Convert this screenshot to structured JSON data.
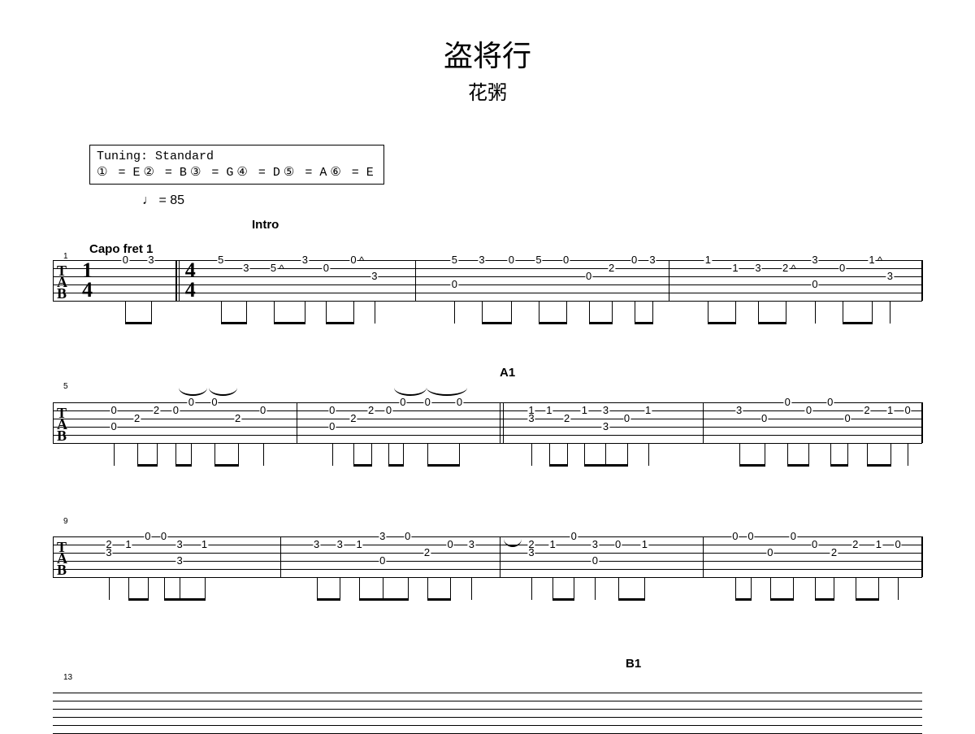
{
  "title": "盗将行",
  "artist": "花粥",
  "tuning": {
    "label": "Tuning: Standard",
    "strings": [
      {
        "num": "①",
        "note": "E"
      },
      {
        "num": "②",
        "note": "B"
      },
      {
        "num": "③",
        "note": "G"
      },
      {
        "num": "④",
        "note": "D"
      },
      {
        "num": "⑤",
        "note": "A"
      },
      {
        "num": "⑥",
        "note": "E"
      }
    ]
  },
  "tempo": {
    "note": "♩",
    "eq": "=",
    "bpm": "85"
  },
  "capo": "Capo fret 1",
  "sections": {
    "intro": "Intro",
    "a1": "A1",
    "b1": "B1"
  },
  "time_signatures": {
    "pickup": {
      "num": "1",
      "den": "4"
    },
    "main": {
      "num": "4",
      "den": "4"
    }
  },
  "bar_numbers": [
    "1",
    "5",
    "9",
    "13"
  ],
  "chart_data": {
    "type": "table",
    "description": "Guitar tablature - 6-line TAB, fret numbers on strings 1-6 (top=string1)",
    "systems": [
      {
        "bars": [
          {
            "label": "pickup",
            "timesig": "1/4",
            "notes": [
              {
                "x": 0.36,
                "string": 1,
                "fret": "0"
              },
              {
                "x": 0.7,
                "string": 1,
                "fret": "3"
              }
            ]
          },
          {
            "timesig": "4/4",
            "notes": [
              {
                "x": 0.1,
                "string": 1,
                "fret": "5"
              },
              {
                "x": 0.22,
                "string": 2,
                "fret": "3"
              },
              {
                "x": 0.35,
                "string": 2,
                "fret": "5",
                "tech": "^"
              },
              {
                "x": 0.5,
                "string": 1,
                "fret": "3"
              },
              {
                "x": 0.6,
                "string": 2,
                "fret": "0"
              },
              {
                "x": 0.73,
                "string": 1,
                "fret": "0",
                "tech": "^"
              },
              {
                "x": 0.83,
                "string": 3,
                "fret": "3"
              }
            ]
          },
          {
            "notes": [
              {
                "x": 0.08,
                "string": 1,
                "fret": "5"
              },
              {
                "x": 0.08,
                "string": 4,
                "fret": "0"
              },
              {
                "x": 0.2,
                "string": 1,
                "fret": "3"
              },
              {
                "x": 0.33,
                "string": 1,
                "fret": "0"
              },
              {
                "x": 0.45,
                "string": 1,
                "fret": "5"
              },
              {
                "x": 0.57,
                "string": 1,
                "fret": "0"
              },
              {
                "x": 0.67,
                "string": 3,
                "fret": "0"
              },
              {
                "x": 0.77,
                "string": 2,
                "fret": "2"
              },
              {
                "x": 0.87,
                "string": 1,
                "fret": "0"
              },
              {
                "x": 0.95,
                "string": 1,
                "fret": "3"
              }
            ]
          },
          {
            "notes": [
              {
                "x": 0.08,
                "string": 1,
                "fret": "1"
              },
              {
                "x": 0.2,
                "string": 2,
                "fret": "1"
              },
              {
                "x": 0.3,
                "string": 2,
                "fret": "3"
              },
              {
                "x": 0.42,
                "string": 2,
                "fret": "2",
                "tech": "^"
              },
              {
                "x": 0.55,
                "string": 1,
                "fret": "3"
              },
              {
                "x": 0.55,
                "string": 4,
                "fret": "0"
              },
              {
                "x": 0.67,
                "string": 2,
                "fret": "0"
              },
              {
                "x": 0.8,
                "string": 1,
                "fret": "1",
                "tech": "^"
              },
              {
                "x": 0.88,
                "string": 3,
                "fret": "3"
              }
            ]
          }
        ]
      },
      {
        "bars": [
          {
            "notes": [
              {
                "x": 0.08,
                "string": 2,
                "fret": "0"
              },
              {
                "x": 0.08,
                "string": 4,
                "fret": "0"
              },
              {
                "x": 0.2,
                "string": 3,
                "fret": "2"
              },
              {
                "x": 0.3,
                "string": 2,
                "fret": "2"
              },
              {
                "x": 0.4,
                "string": 2,
                "fret": "0"
              },
              {
                "x": 0.48,
                "string": 1,
                "fret": "0",
                "tie": true
              },
              {
                "x": 0.6,
                "string": 1,
                "fret": "0"
              },
              {
                "x": 0.72,
                "string": 3,
                "fret": "2"
              },
              {
                "x": 0.85,
                "string": 2,
                "fret": "0"
              }
            ]
          },
          {
            "notes": [
              {
                "x": 0.08,
                "string": 2,
                "fret": "0"
              },
              {
                "x": 0.08,
                "string": 4,
                "fret": "0"
              },
              {
                "x": 0.2,
                "string": 3,
                "fret": "2"
              },
              {
                "x": 0.3,
                "string": 2,
                "fret": "2"
              },
              {
                "x": 0.4,
                "string": 2,
                "fret": "0"
              },
              {
                "x": 0.48,
                "string": 1,
                "fret": "0",
                "tie": true
              },
              {
                "x": 0.62,
                "string": 1,
                "fret": "0",
                "tie": true
              },
              {
                "x": 0.8,
                "string": 1,
                "fret": "0"
              }
            ]
          },
          {
            "section": "A1",
            "notes": [
              {
                "x": 0.06,
                "string": 2,
                "fret": "1"
              },
              {
                "x": 0.06,
                "string": 3,
                "fret": "3"
              },
              {
                "x": 0.16,
                "string": 2,
                "fret": "1"
              },
              {
                "x": 0.26,
                "string": 3,
                "fret": "2"
              },
              {
                "x": 0.36,
                "string": 2,
                "fret": "1"
              },
              {
                "x": 0.48,
                "string": 2,
                "fret": "3"
              },
              {
                "x": 0.48,
                "string": 4,
                "fret": "3"
              },
              {
                "x": 0.6,
                "string": 3,
                "fret": "0"
              },
              {
                "x": 0.72,
                "string": 2,
                "fret": "1"
              }
            ]
          },
          {
            "notes": [
              {
                "x": 0.08,
                "string": 2,
                "fret": "3"
              },
              {
                "x": 0.21,
                "string": 3,
                "fret": "0"
              },
              {
                "x": 0.33,
                "string": 1,
                "fret": "0"
              },
              {
                "x": 0.44,
                "string": 2,
                "fret": "0"
              },
              {
                "x": 0.55,
                "string": 1,
                "fret": "0"
              },
              {
                "x": 0.64,
                "string": 3,
                "fret": "0"
              },
              {
                "x": 0.74,
                "string": 2,
                "fret": "2"
              },
              {
                "x": 0.86,
                "string": 2,
                "fret": "1"
              },
              {
                "x": 0.95,
                "string": 2,
                "fret": "0"
              }
            ]
          }
        ]
      },
      {
        "bars": [
          {
            "notes": [
              {
                "x": 0.06,
                "string": 2,
                "fret": "2"
              },
              {
                "x": 0.06,
                "string": 3,
                "fret": "3"
              },
              {
                "x": 0.17,
                "string": 2,
                "fret": "1"
              },
              {
                "x": 0.28,
                "string": 1,
                "fret": "0"
              },
              {
                "x": 0.37,
                "string": 1,
                "fret": "0"
              },
              {
                "x": 0.46,
                "string": 2,
                "fret": "3"
              },
              {
                "x": 0.46,
                "string": 4,
                "fret": "3"
              },
              {
                "x": 0.6,
                "string": 2,
                "fret": "1"
              }
            ]
          },
          {
            "notes": [
              {
                "x": 0.08,
                "string": 2,
                "fret": "3"
              },
              {
                "x": 0.2,
                "string": 2,
                "fret": "3"
              },
              {
                "x": 0.3,
                "string": 2,
                "fret": "1"
              },
              {
                "x": 0.42,
                "string": 1,
                "fret": "3"
              },
              {
                "x": 0.42,
                "string": 4,
                "fret": "0"
              },
              {
                "x": 0.55,
                "string": 1,
                "fret": "0"
              },
              {
                "x": 0.65,
                "string": 3,
                "fret": "2"
              },
              {
                "x": 0.77,
                "string": 2,
                "fret": "0"
              },
              {
                "x": 0.88,
                "string": 2,
                "fret": "3"
              }
            ]
          },
          {
            "notes": [
              {
                "x": 0.06,
                "string": 2,
                "fret": "2",
                "tie": true
              },
              {
                "x": 0.06,
                "string": 3,
                "fret": "3"
              },
              {
                "x": 0.18,
                "string": 2,
                "fret": "1"
              },
              {
                "x": 0.3,
                "string": 1,
                "fret": "0"
              },
              {
                "x": 0.42,
                "string": 2,
                "fret": "3"
              },
              {
                "x": 0.42,
                "string": 4,
                "fret": "0"
              },
              {
                "x": 0.55,
                "string": 2,
                "fret": "0"
              },
              {
                "x": 0.7,
                "string": 2,
                "fret": "1"
              }
            ]
          },
          {
            "notes": [
              {
                "x": 0.06,
                "string": 1,
                "fret": "0"
              },
              {
                "x": 0.14,
                "string": 1,
                "fret": "0"
              },
              {
                "x": 0.24,
                "string": 3,
                "fret": "0"
              },
              {
                "x": 0.36,
                "string": 1,
                "fret": "0"
              },
              {
                "x": 0.47,
                "string": 2,
                "fret": "0"
              },
              {
                "x": 0.57,
                "string": 3,
                "fret": "2"
              },
              {
                "x": 0.68,
                "string": 2,
                "fret": "2"
              },
              {
                "x": 0.8,
                "string": 2,
                "fret": "1"
              },
              {
                "x": 0.9,
                "string": 2,
                "fret": "0"
              }
            ]
          }
        ]
      }
    ]
  }
}
